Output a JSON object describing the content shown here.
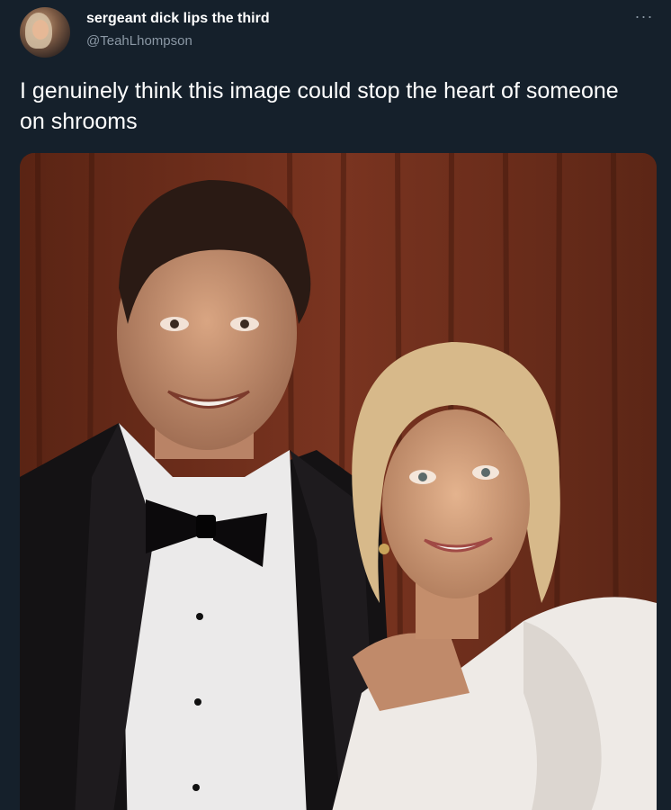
{
  "author": {
    "display_name": "sergeant dick lips the third",
    "username": "@TeahLhompson"
  },
  "tweet": {
    "text": "I genuinely think this image could stop the heart of someone on shrooms"
  },
  "menu": {
    "more_label": "···"
  },
  "colors": {
    "background": "#15202b",
    "text_primary": "#ffffff",
    "text_secondary": "#8b98a5"
  }
}
